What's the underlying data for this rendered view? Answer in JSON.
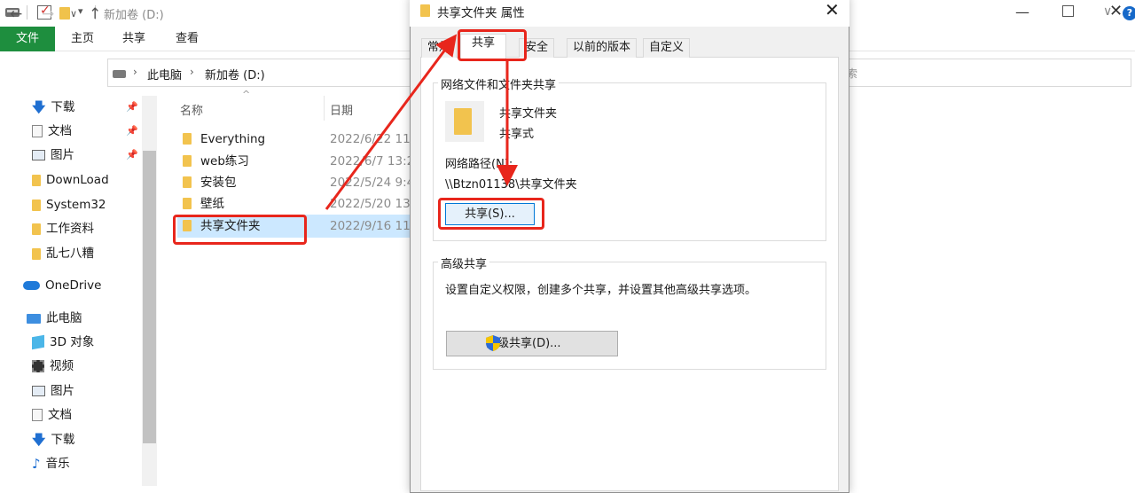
{
  "explorer": {
    "window_title": "新加卷 (D:)",
    "ribbon_tabs": [
      "文件",
      "主页",
      "共享",
      "查看"
    ],
    "breadcrumb": [
      "此电脑",
      "新加卷 (D:)"
    ],
    "search_hint": "索",
    "nav_pane": [
      {
        "label": "下载",
        "icon": "download-icon",
        "pinned": true
      },
      {
        "label": "文档",
        "icon": "document-icon",
        "pinned": true
      },
      {
        "label": "图片",
        "icon": "pictures-icon",
        "pinned": true
      },
      {
        "label": "DownLoad",
        "icon": "folder-icon"
      },
      {
        "label": "System32",
        "icon": "folder-icon"
      },
      {
        "label": "工作资料",
        "icon": "folder-icon"
      },
      {
        "label": "乱七八糟",
        "icon": "folder-icon"
      },
      {
        "label": "OneDrive",
        "icon": "onedrive-icon"
      },
      {
        "label": "此电脑",
        "icon": "computer-icon"
      },
      {
        "label": "3D 对象",
        "icon": "3d-objects-icon"
      },
      {
        "label": "视频",
        "icon": "video-icon"
      },
      {
        "label": "图片",
        "icon": "pictures-icon"
      },
      {
        "label": "文档",
        "icon": "document-icon"
      },
      {
        "label": "下载",
        "icon": "download-icon"
      },
      {
        "label": "音乐",
        "icon": "music-icon"
      }
    ],
    "columns": {
      "name": "名称",
      "date": "日期"
    },
    "files": [
      {
        "name": "Everything",
        "date": "2022/6/22 11"
      },
      {
        "name": "web练习",
        "date": "2022/6/7 13:2"
      },
      {
        "name": "安装包",
        "date": "2022/5/24 9:4"
      },
      {
        "name": "壁纸",
        "date": "2022/5/20 13"
      },
      {
        "name": "共享文件夹",
        "date": "2022/9/16 11",
        "selected": true
      }
    ]
  },
  "dialog": {
    "title": "共享文件夹 属性",
    "tabs": [
      "常规",
      "共享",
      "安全",
      "以前的版本",
      "自定义"
    ],
    "active_tab": "共享",
    "network_group": {
      "label": "网络文件和文件夹共享",
      "folder_name": "共享文件夹",
      "status": "共享式",
      "path_label": "网络路径(N):",
      "path_value": "\\\\Btzn01138\\共享文件夹",
      "share_button": "共享(S)..."
    },
    "advanced_group": {
      "label": "高级共享",
      "description": "设置自定义权限，创建多个共享，并设置其他高级共享选项。",
      "button": "高级共享(D)..."
    }
  },
  "colors": {
    "file_tab": "#1e8e3e",
    "annotation": "#e8261c",
    "selection": "#cce8ff",
    "accent": "#0078d7"
  }
}
